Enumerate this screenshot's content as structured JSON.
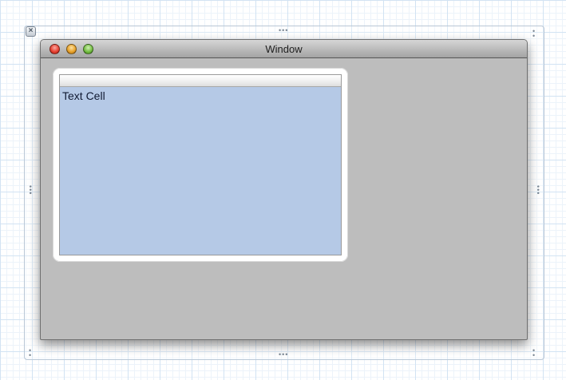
{
  "window": {
    "title": "Window"
  },
  "table": {
    "cell_text": "Text Cell"
  },
  "icons": {
    "frame_close": "close-icon",
    "resize_handles": "resize-handle-icon"
  },
  "colors": {
    "window_background": "#bdbdbd",
    "table_background": "#b5c9e6",
    "close_light": "#e84434",
    "minimize_light": "#e9a42d",
    "zoom_light": "#77c046"
  }
}
